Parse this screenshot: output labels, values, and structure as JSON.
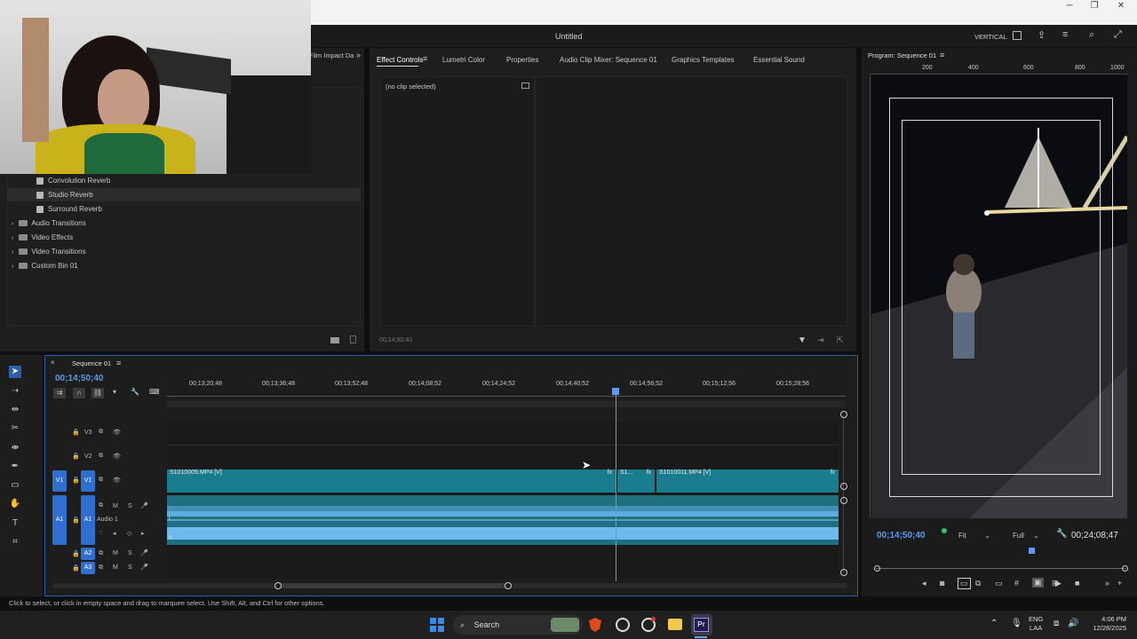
{
  "window": {
    "title": "Untitled",
    "workspace": "VERTICAL",
    "controls": [
      "─",
      "❐",
      "✕"
    ]
  },
  "effects_panel": {
    "tab_fragment": "Film Impact Da",
    "items": [
      {
        "label": "Convolution Reverb",
        "type": "effect"
      },
      {
        "label": "Studio Reverb",
        "type": "effect",
        "selected": true
      },
      {
        "label": "Surround Reverb",
        "type": "effect"
      },
      {
        "label": "Audio Transitions",
        "type": "folder"
      },
      {
        "label": "Video Effects",
        "type": "folder"
      },
      {
        "label": "Video Transitions",
        "type": "folder"
      },
      {
        "label": "Custom Bin 01",
        "type": "folder"
      }
    ]
  },
  "effect_controls": {
    "tabs": [
      "Effect Controls",
      "Lumetri Color",
      "Properties",
      "Audio Clip Mixer: Sequence 01",
      "Graphics Templates",
      "Essential Sound"
    ],
    "empty_text": "(no clip selected)",
    "timecode": "00;14;50;40"
  },
  "program_monitor": {
    "title": "Program: Sequence 01",
    "ruler": [
      "200",
      "400",
      "600",
      "800",
      "1000"
    ],
    "current_time": "00;14;50;40",
    "fit": "Fit",
    "quality": "Full",
    "duration": "00;24;08;47",
    "playhead_fraction": 0.62
  },
  "timeline": {
    "sequence_name": "Sequence 01",
    "current_time": "00;14;50;40",
    "ruler_labels": [
      "00;13;20;48",
      "00;13;36;48",
      "00;13;52;48",
      "00;14;08;52",
      "00;14;24;52",
      "00;14;40;52",
      "00;14;56;52",
      "00;15;12;56",
      "00;15;28;56"
    ],
    "tracks": {
      "v3": "V3",
      "v2": "V2",
      "v1": "V1",
      "a1": "A1",
      "a2": "A2",
      "a3": "A3",
      "audio1": "Audio 1",
      "m": "M",
      "s": "S"
    },
    "clips": {
      "c1": "S1010009.MP4 [V]",
      "c2": "S1...",
      "c3": "S1010011.MP4 [V]",
      "fx": "fx",
      "L": "L",
      "R": "R"
    }
  },
  "status_text": "Click to select, or click in empty space and drag to marquee select. Use Shift, Alt, and Ctrl for other options.",
  "taskbar": {
    "search": "Search",
    "lang1": "ENG",
    "lang2": "LAA",
    "time": "4:06 PM",
    "date": "12/28/2025"
  }
}
